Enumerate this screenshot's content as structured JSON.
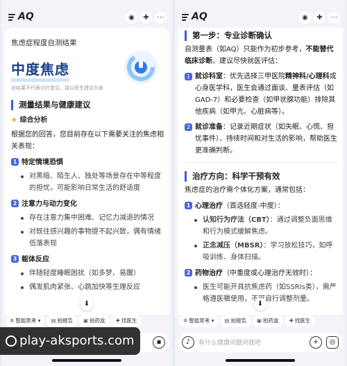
{
  "app": {
    "title": "AQ"
  },
  "left": {
    "card_title": "焦虑症程度自测结果",
    "result": "中度焦虑",
    "disclaimer": "此结果不代表诊疗意见，请以医生建议为准",
    "section_title": "测量结果与健康建议",
    "analysis_title": "综合分析",
    "analysis_text": "根据您的回答，您目前存在以下需要关注的焦虑相关表现：",
    "items": [
      {
        "n": "1",
        "title": "特定情境恐惧",
        "bullets": [
          "对黑暗、陌生人、独处等场景存在中等程度的担忧，可能影响日常生活的舒适度"
        ]
      },
      {
        "n": "2",
        "title": "注意力与动力变化",
        "bullets": [
          "存在注意力集中困难、记忆力减退的情况",
          "对既往感兴趣的事物提不起兴致，偶有情绪低落表现"
        ]
      },
      {
        "n": "3",
        "title": "躯体反应",
        "bullets": [
          "伴随轻度睡眠困扰（如多梦、易醒）",
          "偶发肌肉紧张、心跳加快等生理反应"
        ]
      }
    ]
  },
  "right": {
    "step1_title": "第一步：专业诊断确认",
    "step1_pre": "自测量表（如AQ）只能作为初步参考，",
    "step1_bold": "不能替代临床诊断",
    "step1_post": "。建议尽快就医评估：",
    "step1_items": [
      {
        "n": "1",
        "label": "就诊科室",
        "pre": "：优先选择三甲医院",
        "bold": "精神科/心理科",
        "post": "或心身医学科，医生会通过面谈、量表评估（如GAD-7）和必要检查（如甲状腺功能）排除其他疾病（如甲亢、心脏病等）。"
      },
      {
        "n": "2",
        "label": "就诊准备",
        "text": "：记录近期症状（如失眠、心慌、担忧事件）、持续时间和对生活的影响，帮助医生更准确判断。"
      }
    ],
    "step2_title": "治疗方向：科学干预有效",
    "step2_intro": "焦虑症的治疗需个体化方案，通常包括：",
    "treat": [
      {
        "n": "1",
        "title": "心理治疗",
        "note": "（首选轻度-中度）：",
        "bullets": [
          {
            "bold": "认知行为疗法（CBT）",
            "text": "：通过调整负面思维和行为模式缓解焦虑。"
          },
          {
            "bold": "正念减压（MBSR）",
            "text": "：学习放松技巧，如呼吸训练、身体扫描。"
          }
        ]
      },
      {
        "n": "2",
        "title": "药物治疗",
        "note": "（中重度或心理治疗无效时）：",
        "bullets": [
          {
            "bold": "",
            "text": "医生可能开具抗焦虑药（如SSRIs类），需严格遵医嘱使用，不可自行调整剂量。"
          }
        ]
      }
    ]
  },
  "toolbar": {
    "deep_think": "智能思考",
    "deep_think_caret": "▾",
    "report": "拍报告",
    "medicine": "拍药盒",
    "doctor": "找医生"
  },
  "input": {
    "placeholder": "有什么健康问题问我吧"
  },
  "watermark": "play-aksports.com",
  "colors": {
    "accent": "#4b63e0",
    "title_blue": "#1a3f8a"
  }
}
